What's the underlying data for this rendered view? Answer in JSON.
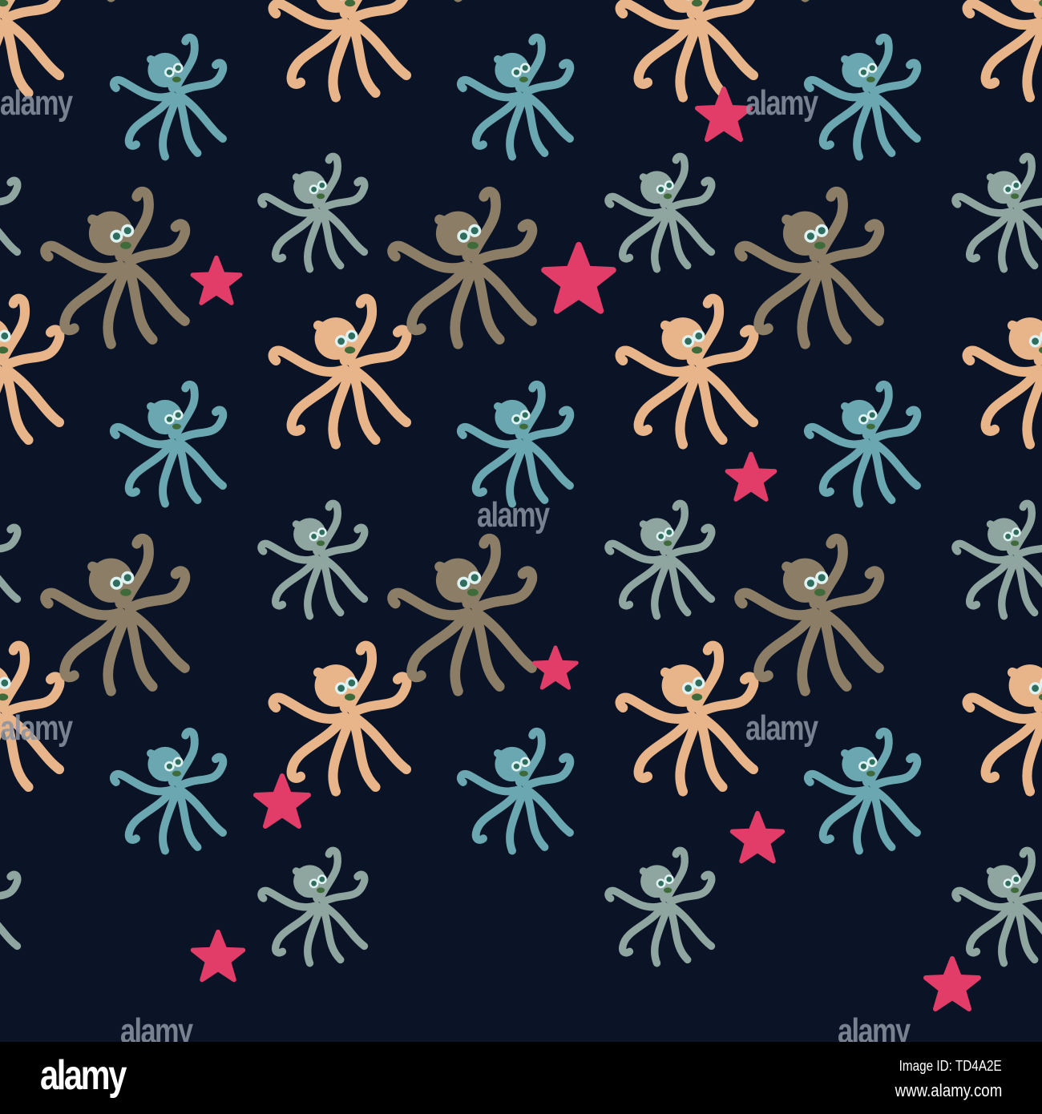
{
  "watermark": "alamy",
  "footer": {
    "logo": "alamy",
    "image_id": "Image ID: TD4A2E",
    "url": "www.alamy.com"
  },
  "colors": {
    "background": "#0a1426",
    "octopus_teal": "#6aa7b0",
    "octopus_olive": "#8c7e66",
    "octopus_grey": "#8fa6a0",
    "octopus_orange": "#e8b48a",
    "starfish": "#e23d68"
  }
}
